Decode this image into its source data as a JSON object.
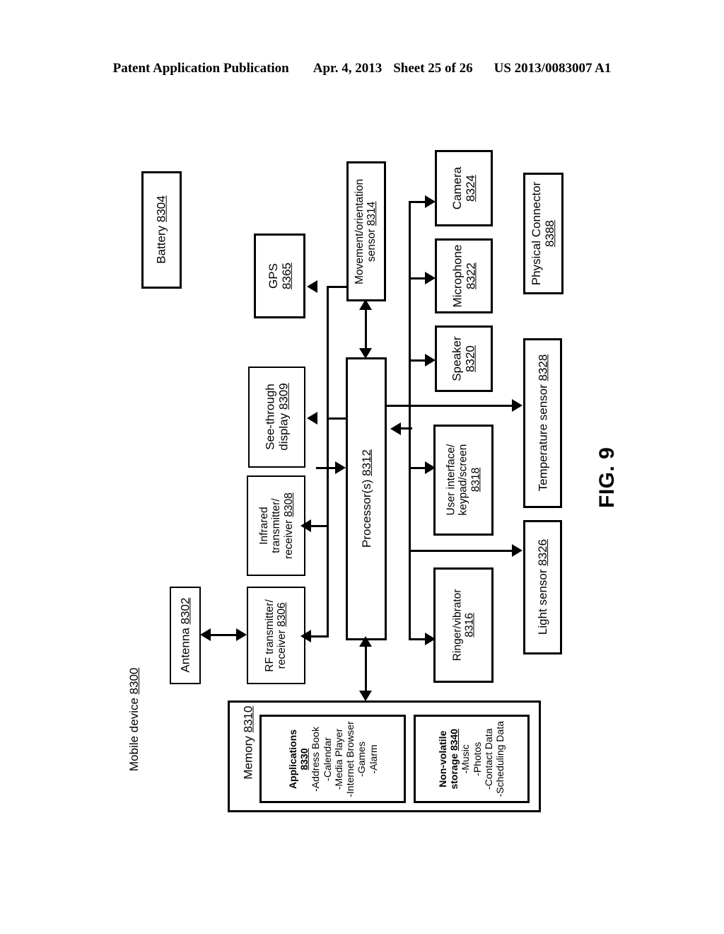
{
  "header": {
    "publication": "Patent Application Publication",
    "date": "Apr. 4, 2013",
    "sheet": "Sheet 25 of 26",
    "doc_number": "US 2013/0083007 A1"
  },
  "figure": {
    "label": "FIG. 9",
    "device_caption": "Mobile device 8300",
    "device_caption_text": "Mobile device ",
    "device_caption_ref": "8300"
  },
  "blocks": {
    "battery": {
      "name": "Battery ",
      "ref": "8304"
    },
    "antenna": {
      "name": "Antenna ",
      "ref": "8302"
    },
    "gps": {
      "name": "GPS",
      "ref": "8365"
    },
    "see_through_display": {
      "line1": "See-through",
      "line2": "display ",
      "ref": "8309"
    },
    "infrared": {
      "line1": "Infrared",
      "line2": "transmitter/",
      "line3": "receiver ",
      "ref": "8308"
    },
    "rf": {
      "line1": "RF transmitter/",
      "line2": "receiver ",
      "ref": "8306"
    },
    "processor": {
      "name": "Processor(s) ",
      "ref": "8312"
    },
    "movement_sensor": {
      "line1": "Movement/orientation",
      "line2": "sensor ",
      "ref": "8314"
    },
    "camera": {
      "name": "Camera",
      "ref": "8324"
    },
    "microphone": {
      "name": "Microphone",
      "ref": "8322"
    },
    "speaker": {
      "name": "Speaker",
      "ref": "8320"
    },
    "physical_connector": {
      "line1": "Physical Connector",
      "ref": "8388"
    },
    "temperature_sensor": {
      "name": "Temperature sensor ",
      "ref": "8328"
    },
    "light_sensor": {
      "name": "Light sensor ",
      "ref": "8326"
    },
    "user_interface": {
      "line1": "User interface/",
      "line2": "keypad/screen",
      "ref": "8318"
    },
    "ringer": {
      "line1": "Ringer/vibrator",
      "ref": "8316"
    },
    "memory": {
      "name": "Memory ",
      "ref": "8310"
    },
    "applications": {
      "title": "Applications",
      "ref": "8330",
      "items": [
        "-Address Book",
        "-Calendar",
        "-Media Player",
        "-Internet Browser",
        "-Games",
        "-Alarm"
      ]
    },
    "nonvolatile_storage": {
      "title_line1": "Non-volatile",
      "title_line2": "storage ",
      "ref": "8340",
      "items": [
        "-Music",
        "-Photos",
        "-Contact Data",
        "-Scheduling Data"
      ]
    }
  },
  "colors": {
    "ink": "#000000",
    "paper": "#ffffff"
  }
}
